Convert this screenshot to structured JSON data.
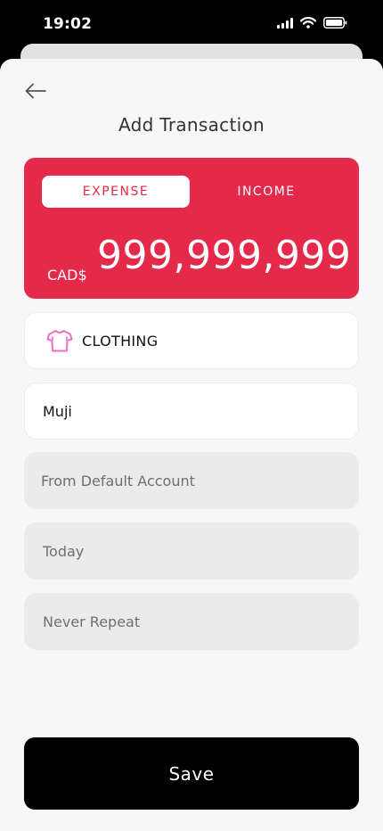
{
  "status_bar": {
    "time": "19:02"
  },
  "header": {
    "title": "Add Transaction"
  },
  "amount_card": {
    "expense_label": "EXPENSE",
    "income_label": "INCOME",
    "selected": "EXPENSE",
    "currency": "CAD$",
    "amount": "999,999,999",
    "accent_color": "#e5294b"
  },
  "form": {
    "category": {
      "label": "CLOTHING",
      "icon": "t-shirt-icon",
      "icon_color": "#ee6fc2"
    },
    "payee": {
      "value": "Muji"
    },
    "account": {
      "placeholder": "From Default Account"
    },
    "date": {
      "placeholder": "Today"
    },
    "repeat": {
      "placeholder": "Never Repeat"
    }
  },
  "save_label": "Save"
}
